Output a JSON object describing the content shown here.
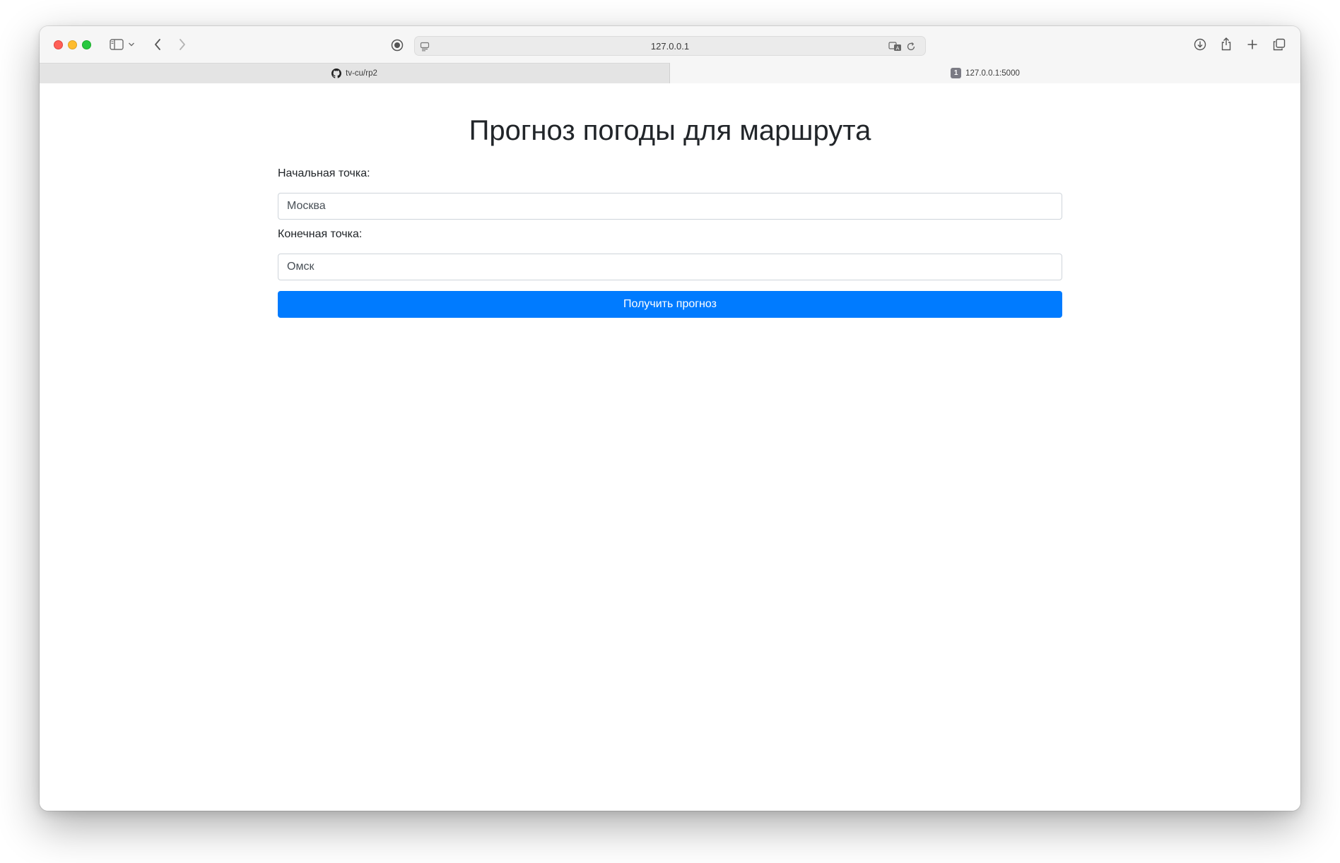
{
  "browser": {
    "address": "127.0.0.1",
    "tabs": [
      {
        "label": "tv-cu/rp2",
        "active": false,
        "favicon": "github-icon"
      },
      {
        "label": "127.0.0.1:5000",
        "active": true,
        "favicon": "1"
      }
    ],
    "tab_close": "×"
  },
  "page": {
    "title": "Прогноз погоды для маршрута",
    "start_label": "Начальная точка:",
    "start_value": "Москва",
    "end_label": "Конечная точка:",
    "end_value": "Омск",
    "submit_label": "Получить прогноз"
  },
  "colors": {
    "primary_button": "#007bff",
    "traffic_red": "#fe5f57",
    "traffic_yellow": "#febc2e",
    "traffic_green": "#28c840"
  }
}
